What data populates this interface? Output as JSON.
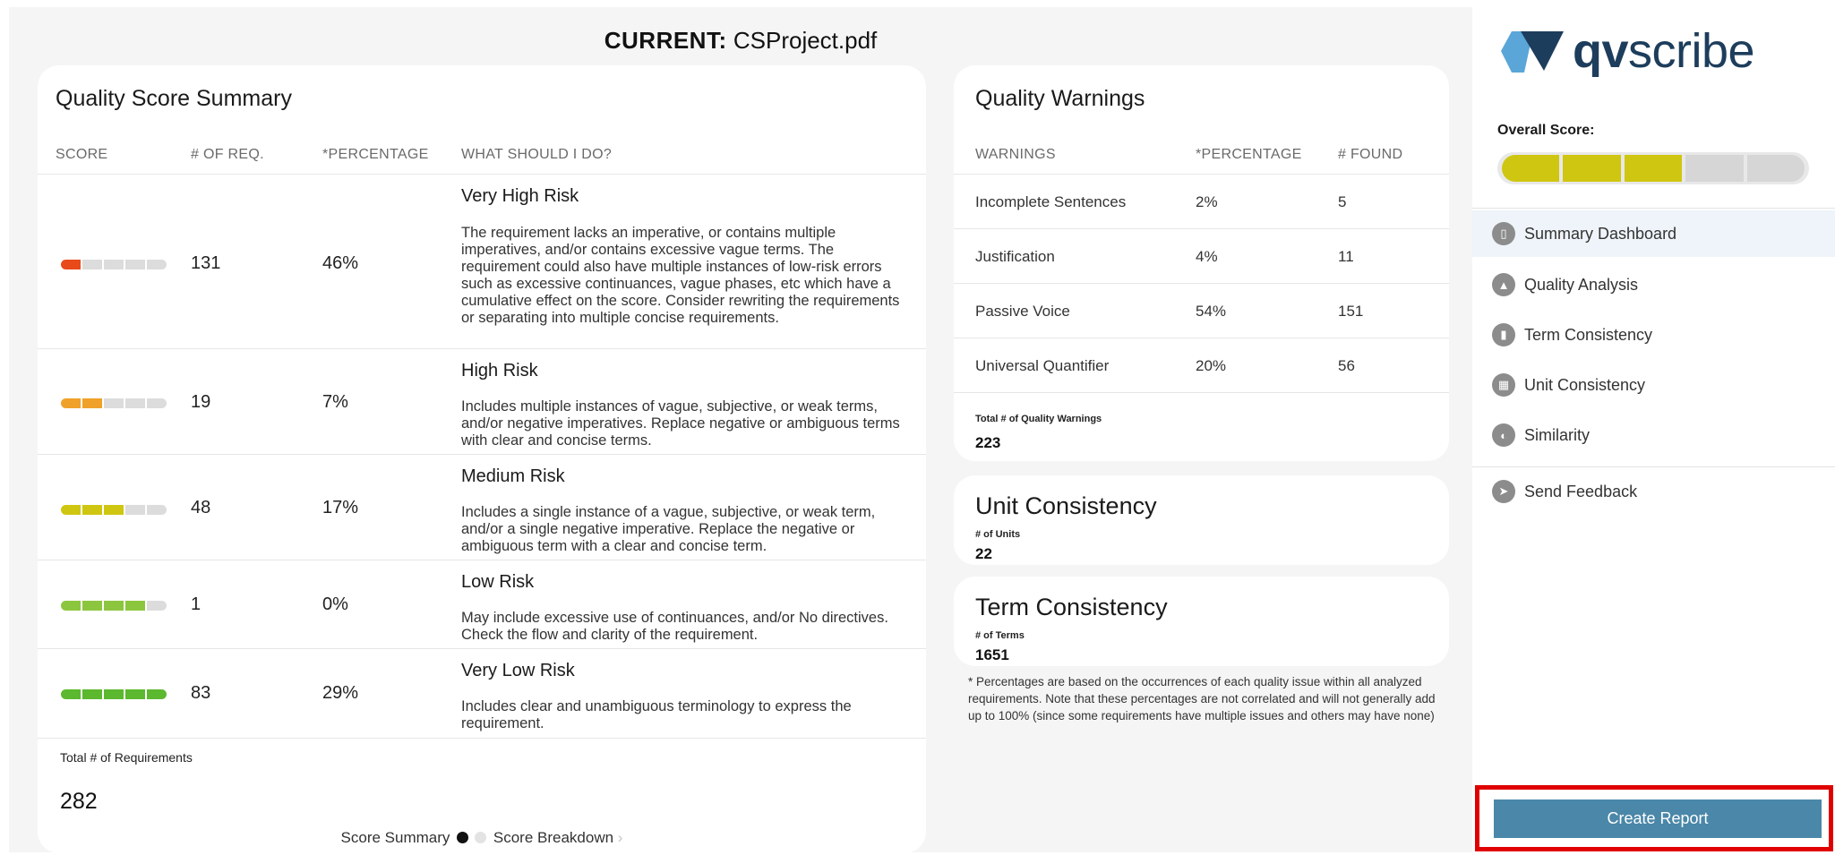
{
  "header": {
    "prefix": "CURRENT:",
    "filename": "CSProject.pdf"
  },
  "summary": {
    "title": "Quality Score Summary",
    "columns": [
      "SCORE",
      "# OF REQ.",
      "*PERCENTAGE",
      "WHAT SHOULD I DO?"
    ],
    "rows": [
      {
        "risk": "Very High Risk",
        "count": "131",
        "percentage": "46%",
        "score_segments": 1,
        "color": "#e84a1a",
        "description": "The requirement lacks an imperative, or contains multiple imperatives, and/or contains excessive vague terms. The requirement could also have multiple instances of low-risk errors such as excessive continuances, vague phases, etc which have a cumulative effect on the score. Consider rewriting the requirements or separating into multiple concise requirements."
      },
      {
        "risk": "High Risk",
        "count": "19",
        "percentage": "7%",
        "score_segments": 2,
        "color": "#f0a12a",
        "description": "Includes multiple instances of vague, subjective, or weak terms, and/or negative imperatives. Replace negative or ambiguous terms with clear and concise terms."
      },
      {
        "risk": "Medium Risk",
        "count": "48",
        "percentage": "17%",
        "score_segments": 3,
        "color": "#cfc611",
        "description": "Includes a single instance of a vague, subjective, or weak term, and/or a single negative imperative. Replace the negative or ambiguous term with a clear and concise term."
      },
      {
        "risk": "Low Risk",
        "count": "1",
        "percentage": "0%",
        "score_segments": 4,
        "color": "#8cc63f",
        "description": "May include excessive use of continuances, and/or No directives. Check the flow and clarity of the requirement."
      },
      {
        "risk": "Very Low Risk",
        "count": "83",
        "percentage": "29%",
        "score_segments": 5,
        "color": "#5cb82e",
        "description": "Includes clear and unambiguous terminology to express the requirement."
      }
    ],
    "total_label": "Total # of Requirements",
    "total_value": "282",
    "pager": {
      "left": "Score Summary",
      "right": "Score Breakdown",
      "chevron": "›"
    }
  },
  "warnings": {
    "title": "Quality Warnings",
    "columns": [
      "WARNINGS",
      "*PERCENTAGE",
      "# FOUND"
    ],
    "rows": [
      {
        "name": "Incomplete Sentences",
        "percentage": "2%",
        "found": "5"
      },
      {
        "name": "Justification",
        "percentage": "4%",
        "found": "11"
      },
      {
        "name": "Passive Voice",
        "percentage": "54%",
        "found": "151"
      },
      {
        "name": "Universal Quantifier",
        "percentage": "20%",
        "found": "56"
      }
    ],
    "total_label": "Total # of Quality Warnings",
    "total_value": "223"
  },
  "unit_consistency": {
    "title": "Unit Consistency",
    "label": "# of Units",
    "value": "22"
  },
  "term_consistency": {
    "title": "Term Consistency",
    "label": "# of Terms",
    "value": "1651"
  },
  "footnote": "* Percentages are based on the occurrences of each quality issue within all analyzed requirements. Note that these percentages are not correlated and will not generally add up to 100% (since some requirements have multiple issues and others may have none)",
  "sidebar": {
    "logo_bold": "qv",
    "logo_light": "scribe",
    "overall_label": "Overall Score:",
    "overall_segments_filled": 3,
    "overall_segments_total": 5,
    "overall_color": "#cfc611",
    "nav": [
      {
        "label": "Summary Dashboard",
        "icon": "dashboard-icon",
        "active": true
      },
      {
        "label": "Quality Analysis",
        "icon": "warning-icon",
        "active": false
      },
      {
        "label": "Term Consistency",
        "icon": "book-icon",
        "active": false
      },
      {
        "label": "Unit Consistency",
        "icon": "grid-icon",
        "active": false
      },
      {
        "label": "Similarity",
        "icon": "overlap-icon",
        "active": false
      }
    ],
    "feedback": {
      "label": "Send Feedback",
      "icon": "send-icon"
    },
    "create_report": "Create Report"
  }
}
